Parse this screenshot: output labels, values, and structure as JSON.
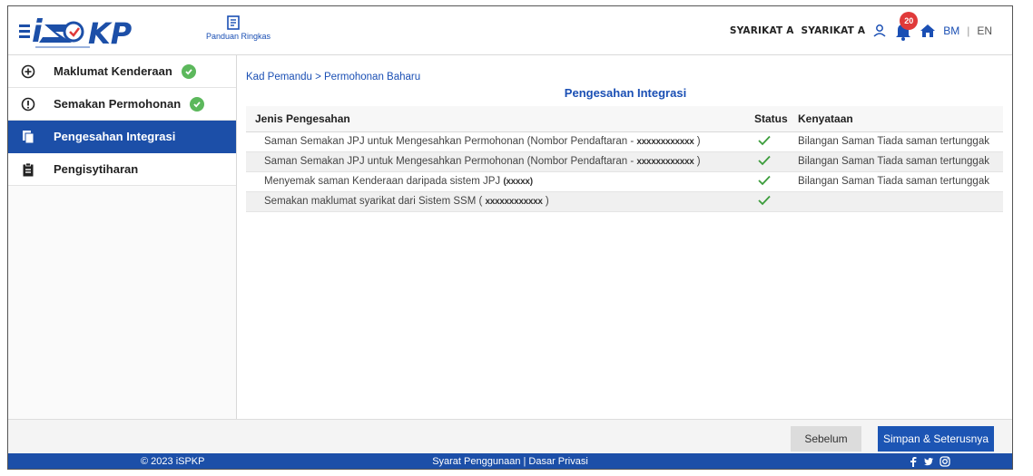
{
  "header": {
    "logo_text": "iSPKP",
    "guide_label": "Panduan Ringkas",
    "company_1": "SYARIKAT A",
    "company_2": "SYARIKAT A",
    "notification_count": "20",
    "lang_bm": "BM",
    "lang_separator": "|",
    "lang_en": "EN"
  },
  "sidebar": {
    "items": [
      {
        "label": "Maklumat Kenderaan",
        "icon": "plus-circle-icon",
        "completed": true,
        "active": false
      },
      {
        "label": "Semakan Permohonan",
        "icon": "info-circle-icon",
        "completed": true,
        "active": false
      },
      {
        "label": "Pengesahan Integrasi",
        "icon": "copy-document-icon",
        "completed": false,
        "active": true
      },
      {
        "label": "Pengisytiharan",
        "icon": "clipboard-icon",
        "completed": false,
        "active": false
      }
    ]
  },
  "main": {
    "breadcrumb": "Kad Pemandu > Permohonan Baharu",
    "title": "Pengesahan Integrasi",
    "table": {
      "headers": [
        "Jenis Pengesahan",
        "Status",
        "Kenyataan"
      ],
      "rows": [
        {
          "type": "Saman Semakan JPJ untuk Mengesahkan Permohonan (Nombor Pendaftaran - ",
          "masked": "xxxxxxxxxxxx",
          "suffix": " )",
          "status": "ok",
          "note": "Bilangan Saman Tiada saman tertunggak"
        },
        {
          "type": "Saman Semakan JPJ untuk Mengesahkan Permohonan (Nombor Pendaftaran - ",
          "masked": "xxxxxxxxxxxx",
          "suffix": " )",
          "status": "ok",
          "note": "Bilangan Saman Tiada saman tertunggak"
        },
        {
          "type": "Menyemak saman Kenderaan daripada sistem JPJ ",
          "masked": "(xxxxx)",
          "suffix": "",
          "status": "ok",
          "note": "Bilangan Saman Tiada saman tertunggak"
        },
        {
          "type": "Semakan maklumat syarikat dari Sistem SSM ( ",
          "masked": "xxxxxxxxxxxx",
          "suffix": " )",
          "status": "ok",
          "note": ""
        }
      ]
    }
  },
  "actions": {
    "prev_label": "Sebelum",
    "next_label": "Simpan & Seterusnya"
  },
  "footer": {
    "copyright": "© 2023 iSPKP",
    "terms": "Syarat Penggunaan | Dasar Privasi",
    "social": [
      "facebook-icon",
      "twitter-icon",
      "instagram-icon"
    ]
  },
  "colors": {
    "primary": "#1c4fa8",
    "check": "#5cb85c",
    "badge": "#e03a3a"
  }
}
